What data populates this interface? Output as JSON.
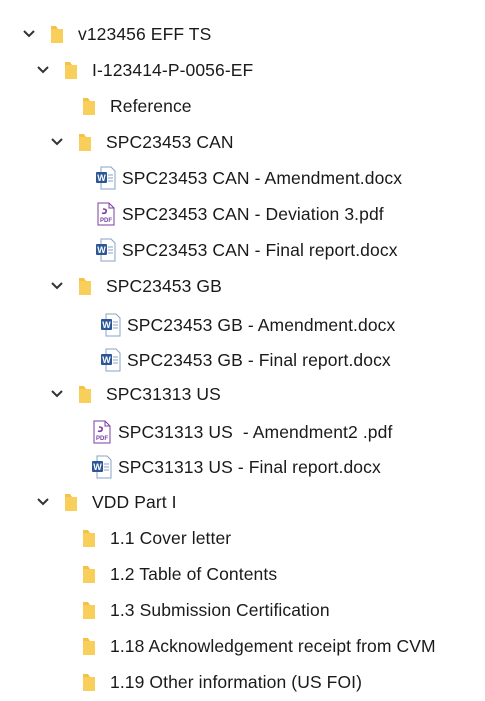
{
  "tree": {
    "root": {
      "label": "v123456 EFF TS",
      "expanded": true,
      "icon": "folder-icon"
    },
    "i_folder": {
      "label": "I-123414-P-0056-EF",
      "expanded": true,
      "icon": "folder-icon"
    },
    "reference": {
      "label": "Reference",
      "icon": "folder-icon"
    },
    "can": {
      "label": "SPC23453 CAN",
      "expanded": true,
      "icon": "folder-icon",
      "files": [
        {
          "label": "SPC23453 CAN - Amendment.docx",
          "type": "word"
        },
        {
          "label": "SPC23453 CAN - Deviation 3.pdf",
          "type": "pdf"
        },
        {
          "label": "SPC23453 CAN - Final report.docx",
          "type": "word"
        }
      ]
    },
    "gb": {
      "label": "SPC23453 GB",
      "expanded": true,
      "icon": "folder-icon",
      "files": [
        {
          "label": "SPC23453 GB - Amendment.docx",
          "type": "word"
        },
        {
          "label": "SPC23453 GB - Final report.docx",
          "type": "word"
        }
      ]
    },
    "us": {
      "label": "SPC31313 US",
      "expanded": true,
      "icon": "folder-icon",
      "files": [
        {
          "label": "SPC31313 US  - Amendment2 .pdf",
          "type": "pdf"
        },
        {
          "label": "SPC31313 US - Final report.docx",
          "type": "word"
        }
      ]
    },
    "vdd": {
      "label": "VDD Part I",
      "expanded": true,
      "icon": "folder-icon",
      "items": [
        {
          "label": "1.1 Cover letter"
        },
        {
          "label": "1.2 Table of Contents"
        },
        {
          "label": "1.3 Submission Certification"
        },
        {
          "label": "1.18 Acknowledgement receipt from CVM"
        },
        {
          "label": "1.19 Other information (US FOI)"
        }
      ]
    }
  },
  "colors": {
    "folder": "#f6c244",
    "chevron": "#333333",
    "word": "#2b5797",
    "pdf": "#7a3f9d"
  }
}
